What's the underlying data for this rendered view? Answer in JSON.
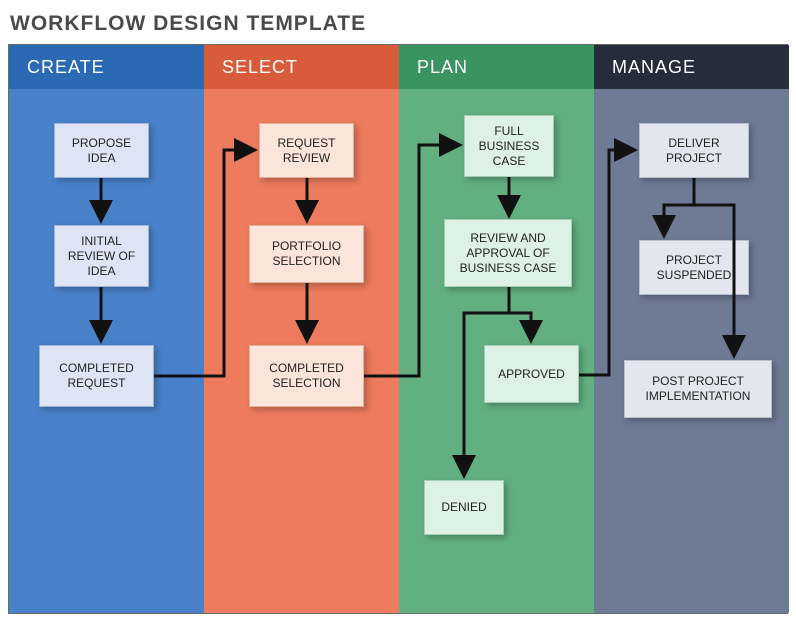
{
  "title": "WORKFLOW DESIGN TEMPLATE",
  "columns": [
    {
      "label": "CREATE"
    },
    {
      "label": "SELECT"
    },
    {
      "label": "PLAN"
    },
    {
      "label": "MANAGE"
    }
  ],
  "boxes": {
    "propose_idea": "PROPOSE IDEA",
    "initial_review": "INITIAL REVIEW OF IDEA",
    "completed_request": "COMPLETED REQUEST",
    "request_review": "REQUEST REVIEW",
    "portfolio_selection": "PORTFOLIO SELECTION",
    "completed_selection": "COMPLETED SELECTION",
    "full_business_case": "FULL BUSINESS CASE",
    "review_business_case": "REVIEW AND APPROVAL OF BUSINESS CASE",
    "approved": "APPROVED",
    "denied": "DENIED",
    "deliver_project": "DELIVER PROJECT",
    "project_suspended": "PROJECT SUSPENDED",
    "post_project": "POST PROJECT IMPLEMENTATION"
  }
}
